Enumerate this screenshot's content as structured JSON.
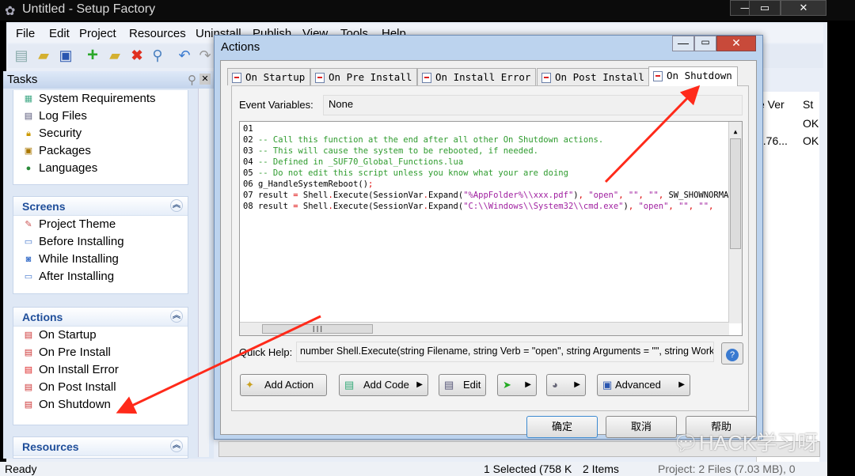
{
  "window": {
    "title": "Untitled - Setup Factory",
    "min": "—",
    "max": "▭",
    "close": "✕"
  },
  "menu": [
    "File",
    "Edit",
    "Project",
    "Resources",
    "Uninstall",
    "Publish",
    "View",
    "Tools",
    "Help"
  ],
  "toolbar_icons": [
    "new-icon",
    "open-icon",
    "save-icon",
    "add-icon",
    "add-folder-icon",
    "delete-icon",
    "search-icon",
    "undo-icon",
    "redo-icon"
  ],
  "tasks": {
    "title": "Tasks",
    "top_items": [
      {
        "label": "System Requirements"
      },
      {
        "label": "Log Files"
      },
      {
        "label": "Security"
      },
      {
        "label": "Packages"
      },
      {
        "label": "Languages"
      }
    ],
    "screens": {
      "title": "Screens",
      "items": [
        {
          "label": "Project Theme"
        },
        {
          "label": "Before Installing"
        },
        {
          "label": "While Installing"
        },
        {
          "label": "After Installing"
        }
      ]
    },
    "actions": {
      "title": "Actions",
      "items": [
        {
          "label": "On Startup"
        },
        {
          "label": "On Pre Install"
        },
        {
          "label": "On Install Error"
        },
        {
          "label": "On Post Install"
        },
        {
          "label": "On Shutdown"
        }
      ]
    },
    "resources": {
      "title": "Resources"
    }
  },
  "right_pane": {
    "headers": [
      "e Ver",
      "St"
    ],
    "rows": [
      [
        "",
        "OK"
      ],
      [
        "1.76...",
        "OK"
      ]
    ]
  },
  "dialog": {
    "title": "Actions",
    "tabs": [
      {
        "label": "On Startup"
      },
      {
        "label": "On Pre Install"
      },
      {
        "label": "On Install Error"
      },
      {
        "label": "On Post Install"
      },
      {
        "label": "On Shutdown",
        "active": true
      }
    ],
    "event_label": "Event Variables:",
    "event_value": "None",
    "code": [
      [
        [
          "01 ",
          "#000"
        ]
      ],
      [
        [
          "02 ",
          "#000"
        ],
        [
          "-- Call this function at the end after all other On Shutdown actions.",
          "#2e9b2e"
        ]
      ],
      [
        [
          "03 ",
          "#000"
        ],
        [
          "-- This will cause the system to be rebooted, if needed.",
          "#2e9b2e"
        ]
      ],
      [
        [
          "04 ",
          "#000"
        ],
        [
          "-- Defined in _SUF70_Global_Functions.lua",
          "#2e9b2e"
        ]
      ],
      [
        [
          "05 ",
          "#000"
        ],
        [
          "-- Do not edit this script unless you know what your are doing",
          "#2e9b2e"
        ]
      ],
      [
        [
          "06 g_HandleSystemReboot()",
          "#000"
        ],
        [
          ";",
          "#d00"
        ]
      ],
      [
        [
          "07 result ",
          "#000"
        ],
        [
          "=",
          "#d00"
        ],
        [
          " Shell",
          "#000"
        ],
        [
          ".",
          "#d00"
        ],
        [
          "Execute(SessionVar",
          "#000"
        ],
        [
          ".",
          "#d00"
        ],
        [
          "Expand(",
          "#000"
        ],
        [
          "\"%AppFolder%\\\\xxx.pdf\"",
          "#a020a0"
        ],
        [
          ")",
          "#000"
        ],
        [
          ", ",
          "#d00"
        ],
        [
          "\"open\"",
          "#a020a0"
        ],
        [
          ", ",
          "#d00"
        ],
        [
          "\"\"",
          "#a020a0"
        ],
        [
          ", ",
          "#d00"
        ],
        [
          "\"\"",
          "#a020a0"
        ],
        [
          ", ",
          "#d00"
        ],
        [
          "SW_SHOWNORMAL",
          "#000"
        ]
      ],
      [
        [
          "08 result ",
          "#000"
        ],
        [
          "=",
          "#d00"
        ],
        [
          " Shell",
          "#000"
        ],
        [
          ".",
          "#d00"
        ],
        [
          "Execute(SessionVar",
          "#000"
        ],
        [
          ".",
          "#d00"
        ],
        [
          "Expand(",
          "#000"
        ],
        [
          "\"C:\\\\Windows\\\\System32\\\\cmd.exe\"",
          "#a020a0"
        ],
        [
          ")",
          "#000"
        ],
        [
          ", ",
          "#d00"
        ],
        [
          "\"open\"",
          "#a020a0"
        ],
        [
          ", ",
          "#d00"
        ],
        [
          "\"\"",
          "#a020a0"
        ],
        [
          ", ",
          "#d00"
        ],
        [
          "\"\"",
          "#a020a0"
        ],
        [
          ",",
          "#d00"
        ]
      ]
    ],
    "quick_help_label": "Quick Help:",
    "quick_help": "number Shell.Execute(string Filename, string Verb = \"open\", string Arguments = \"\", string WorkingFolder",
    "buttons": {
      "add_action": "Add Action",
      "add_code": "Add Code",
      "edit": "Edit",
      "advanced": "Advanced"
    },
    "ok": "确定",
    "cancel": "取消",
    "help": "帮助"
  },
  "status": {
    "ready": "Ready",
    "selected": "1 Selected (758 K",
    "items": "2 Items",
    "project": "Project: 2 Files (7.03 MB), 0"
  },
  "watermark": "HACK学习呀",
  "colors": {
    "arrow": "#ff2a1a",
    "comment": "#2e9b2e",
    "string": "#a020a0",
    "operator": "#d00"
  }
}
